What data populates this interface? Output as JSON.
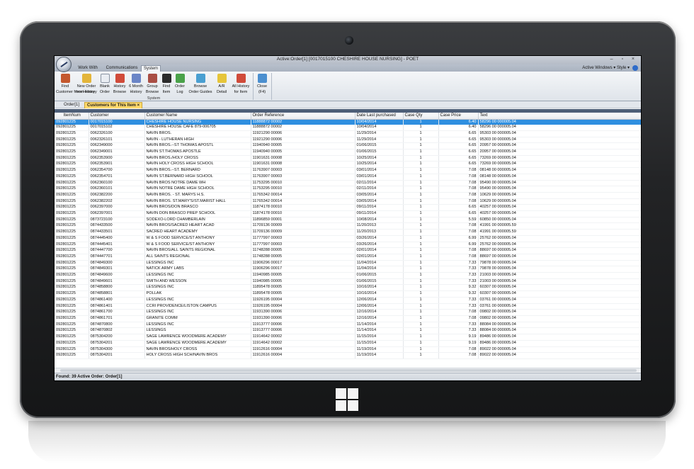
{
  "window": {
    "title": "Active:Order[1] [0017015100 CHESHIRE HOUSE NURSING] - POET",
    "controls": "– ▫ ×"
  },
  "ribbon_tabs": [
    {
      "label": "Work With"
    },
    {
      "label": "Communications"
    },
    {
      "label": "System"
    }
  ],
  "right_links": "Active Windows ▾  Style ▾",
  "ribbon_buttons": [
    {
      "label1": "Find",
      "label2": "Customer from History",
      "icon": "find-customer-icon",
      "color": "#c4582e"
    },
    {
      "label1": "New Order",
      "label2": "from History",
      "icon": "new-order-icon",
      "color": "#e3b53a"
    },
    {
      "label1": "Blank",
      "label2": "Order",
      "icon": "blank-order-icon",
      "color": "#e9edf2"
    },
    {
      "label1": "History",
      "label2": "Browse",
      "icon": "history-browse-icon",
      "color": "#d04b3a"
    },
    {
      "label1": "6 Month",
      "label2": "History",
      "icon": "six-month-history-icon",
      "color": "#6a85c7"
    },
    {
      "label1": "Group",
      "label2": "Browse",
      "icon": "group-browse-icon",
      "color": "#a94e45"
    },
    {
      "label1": "Find",
      "label2": "Item",
      "icon": "binoculars-icon",
      "color": "#2c2c2c"
    },
    {
      "label1": "Order",
      "label2": "Log",
      "icon": "order-log-icon",
      "color": "#4aa24a"
    },
    {
      "label1": "Browse",
      "label2": "Order Guides",
      "icon": "order-guides-icon",
      "color": "#4a9fd1"
    },
    {
      "label1": "A/R",
      "label2": "Detail",
      "icon": "ar-detail-icon",
      "color": "#e6c53a"
    },
    {
      "label1": "All History",
      "label2": "for Item",
      "icon": "all-history-icon",
      "color": "#d04b3a"
    },
    {
      "label1": "Close",
      "label2": "(F4)",
      "icon": "close-icon",
      "color": "#4b8fcf"
    }
  ],
  "ribbon_group_label": "System",
  "doc_tabs": [
    {
      "label": "Order[1]"
    },
    {
      "label": "Customers for This Item ×"
    }
  ],
  "columns": [
    "ItemNum",
    "Customer",
    "Customer Name",
    "Order Reference",
    "Date Last purchased",
    "Case Qty",
    "Case Price",
    "Text"
  ],
  "rows": [
    [
      "092801225",
      "0017015100",
      "CHESHIRE HOUSE NURSING",
      "11888872 00002",
      "10/04/2014",
      "1",
      "6.40",
      "58296 00 000005.04"
    ],
    [
      "092801225",
      "0017015102",
      "CHESHIRE HOUSE CAFE 879-006705",
      "11888872 00002",
      "10/04/2014",
      "1",
      "6.40",
      "58296 00 000005.04"
    ],
    [
      "092801225",
      "0062326100",
      "NAVIN BROS.",
      "11921290 00006",
      "11/29/2014",
      "1",
      "6.65",
      "95303 00 000005.04"
    ],
    [
      "092801225",
      "0062326101",
      "NAVIN - LUTHERAN HIGH",
      "11921290 00006",
      "11/29/2014",
      "1",
      "6.65",
      "95303 00 000005.04"
    ],
    [
      "092801225",
      "0062349000",
      "NAVIN BROS.--ST THOMAS APOSTL",
      "11940940 00005",
      "01/06/2015",
      "1",
      "6.65",
      "20957 00 000005.04"
    ],
    [
      "092801225",
      "0062349001",
      "NAVIN ST.THOMAS APOSTLE",
      "11940940 00005",
      "01/06/2015",
      "1",
      "6.65",
      "20957 00 000005.04"
    ],
    [
      "092801225",
      "0062353900",
      "NAVIN BROS./HOLY CROSS",
      "11901631 00008",
      "10/25/2014",
      "1",
      "6.65",
      "73269 00 000005.04"
    ],
    [
      "092801225",
      "0062353901",
      "NAVIN HOLY CROSS HIGH SCHOOL",
      "11901631 00008",
      "10/25/2014",
      "1",
      "6.65",
      "73269 00 000005.04"
    ],
    [
      "092801225",
      "0062354700",
      "NAVIN BROS.--ST. BERNARD",
      "11763907 00003",
      "03/01/2014",
      "1",
      "7.08",
      "08148 00 000005.04"
    ],
    [
      "092801225",
      "0062354701",
      "NAVIN ST.BERNARD HIGH SCHOOL",
      "11763907 00003",
      "03/01/2014",
      "1",
      "7.08",
      "08148 00 000005.04"
    ],
    [
      "092801225",
      "0062360100",
      "NAVIN BROS NOTRE DAME WH",
      "11753295 00010",
      "02/11/2014",
      "1",
      "7.08",
      "95490 00 000005.04"
    ],
    [
      "092801225",
      "0062360101",
      "NAVIN NOTRE DAME HIGH SCHOOL",
      "11753295 00010",
      "02/11/2014",
      "1",
      "7.08",
      "95490 00 000005.04"
    ],
    [
      "092801225",
      "0062382200",
      "NAVIN BROS. - ST. MARYS H.S.",
      "11765342 00014",
      "03/05/2014",
      "1",
      "7.08",
      "10629 00 000005.04"
    ],
    [
      "092801225",
      "0062382202",
      "NAVIN BROS. ST.MARY'S/ST.MARIST HALL",
      "11765342 00014",
      "03/05/2014",
      "1",
      "7.08",
      "10629 00 000005.04"
    ],
    [
      "092801225",
      "0062397000",
      "NAVIN BROS/DON BRASCO",
      "11874178 00010",
      "09/11/2014",
      "1",
      "6.65",
      "40257 00 000005.04"
    ],
    [
      "092801225",
      "0062397001",
      "NAVIN DON BRASCO PREP SCHOOL",
      "11874178 00010",
      "09/11/2014",
      "1",
      "6.65",
      "40257 00 000005.04"
    ],
    [
      "092801225",
      "0873723100",
      "SODEXO-LORD CHAMBERLAIN",
      "11896859 00001",
      "10/08/2014",
      "1",
      "5.59",
      "60850 00 000005.04"
    ],
    [
      "092801225",
      "0874433500",
      "NAVIN BROS/SACRED HEART ACAD",
      "11709136 00009",
      "11/20/2013",
      "1",
      "7.08",
      "41991 00 000005.59"
    ],
    [
      "092801225",
      "0874433501",
      "SACRED HEART ACADEMY",
      "11709136 00009",
      "11/20/2013",
      "1",
      "7.08",
      "41991 00 000005.59"
    ],
    [
      "092801225",
      "0874445400",
      "W & S FOOD SERVICE/ST ANTHONY",
      "11777997 00003",
      "03/26/2014",
      "1",
      "6.99",
      "25762 00 000005.04"
    ],
    [
      "092801225",
      "0874445401",
      "W & S FOOD SERVICE/ST ANTHONY",
      "11777997 00003",
      "03/26/2014",
      "1",
      "6.99",
      "25762 00 000005.04"
    ],
    [
      "092801225",
      "0874447700",
      "NAVIN BROS/ALL SAINTS REGIONAL",
      "11748288 00005",
      "02/01/2014",
      "1",
      "7.08",
      "88697 00 000005.04"
    ],
    [
      "092801225",
      "0874447701",
      "ALL SAINTS REGIONAL",
      "11748288 00005",
      "02/01/2014",
      "1",
      "7.08",
      "88697 00 000005.04"
    ],
    [
      "092801225",
      "0874849300",
      "LESSINGS INC",
      "11906296 00017",
      "11/04/2014",
      "1",
      "7.33",
      "79878 00 000005.04"
    ],
    [
      "092801225",
      "0874849301",
      "NATICK ARMY LABS",
      "11906296 00017",
      "11/04/2014",
      "1",
      "7.33",
      "79878 00 000005.04"
    ],
    [
      "092801225",
      "0874849600",
      "LESSINGS INC",
      "11940985 00005",
      "01/06/2015",
      "1",
      "7.33",
      "21003 00 000005.04"
    ],
    [
      "092801225",
      "0874849601",
      "SMITH AND WESSON",
      "11940985 00005",
      "01/06/2015",
      "1",
      "7.33",
      "21003 00 000005.04"
    ],
    [
      "092801225",
      "0874858800",
      "LESSINGS INC",
      "11895478 00005",
      "10/16/2014",
      "1",
      "9.32",
      "60307 00 000005.04"
    ],
    [
      "092801225",
      "0874858801",
      "POLLAK",
      "11895478 00005",
      "10/16/2014",
      "1",
      "9.32",
      "60307 00 000005.04"
    ],
    [
      "092801225",
      "0874861400",
      "LESSINGS INC",
      "11926195 00004",
      "12/06/2014",
      "1",
      "7.33",
      "03761 00 000005.04"
    ],
    [
      "092801225",
      "0874861401",
      "CCRI PROVIDENCE/LISTON CAMPUS",
      "11926195 00004",
      "12/06/2014",
      "1",
      "7.33",
      "03761 00 000005.04"
    ],
    [
      "092801225",
      "0874861700",
      "LESSINGS INC",
      "11931390 00006",
      "12/16/2014",
      "1",
      "7.08",
      "09802 00 000005.04"
    ],
    [
      "092801225",
      "0874861701",
      "GRANITE COMM",
      "11931390 00006",
      "12/16/2014",
      "1",
      "7.08",
      "09802 00 000005.04"
    ],
    [
      "092801225",
      "0874870800",
      "LESSINGS INC",
      "11913777 00006",
      "11/14/2014",
      "1",
      "7.33",
      "88084 00 000005.04"
    ],
    [
      "092801225",
      "0874870802",
      "LESSINGS",
      "11913777 00006",
      "11/14/2014",
      "1",
      "7.33",
      "88084 00 000005.04"
    ],
    [
      "092801225",
      "0875304200",
      "SAGE LAWRENCE WOODMERE ACADEMY",
      "11914642 00002",
      "11/15/2014",
      "1",
      "9.19",
      "89486 00 000005.04"
    ],
    [
      "092801225",
      "0875304201",
      "SAGE LAWRENCE WOODMERE ACADEMY",
      "11914642 00002",
      "11/15/2014",
      "1",
      "9.19",
      "89486 00 000005.04"
    ],
    [
      "092801225",
      "0875304300",
      "NAVIN BROS/HOLY CROSS",
      "11912616 00004",
      "11/19/2014",
      "1",
      "7.08",
      "89022 00 000005.04"
    ],
    [
      "092801225",
      "0875304201",
      "HOLY CROSS HIGH SCH/NAVIN BROS",
      "11912616 00004",
      "11/19/2014",
      "1",
      "7.08",
      "89022 00 000005.04"
    ]
  ],
  "status": "Found: 39   Active Order: Order[1]",
  "accent": "#2f8fe0"
}
